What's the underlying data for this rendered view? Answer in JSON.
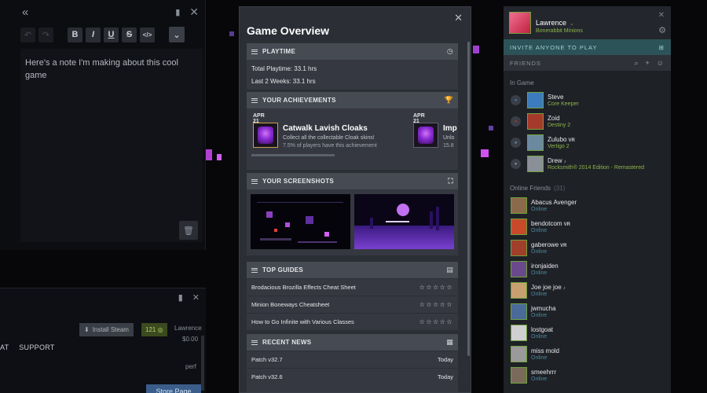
{
  "notes": {
    "note_text": "Here's a note I'm making about this cool game",
    "format_buttons": [
      "B",
      "I",
      "U",
      "S",
      "</>"
    ]
  },
  "store": {
    "install_label": "Install Steam",
    "points": "121",
    "user": "Lawrence",
    "balance": "$0.00",
    "nav": [
      "AT",
      "SUPPORT"
    ],
    "perf": "perf",
    "store_page_label": "Store Page"
  },
  "overview": {
    "title": "Game Overview",
    "playtime": {
      "header": "PLAYTIME",
      "total": "Total Playtime: 33.1 hrs",
      "last_two_weeks": "Last 2 Weeks: 33.1 hrs"
    },
    "achievements": {
      "header": "YOUR ACHIEVEMENTS",
      "items": [
        {
          "date": "APR 21",
          "name": "Catwalk Lavish Cloaks",
          "desc": "Collect all the collectable Cloak skins!",
          "pct": "7.5% of players have this achievement"
        },
        {
          "date": "APR 21",
          "name": "Imp",
          "desc": "Unlo",
          "pct": "15.8"
        }
      ]
    },
    "screenshots": {
      "header": "YOUR SCREENSHOTS"
    },
    "guides": {
      "header": "TOP GUIDES",
      "items": [
        {
          "title": "Brodacious Brozilla Effects Cheat Sheet",
          "stars": "☆☆☆☆☆"
        },
        {
          "title": "Minion Boneways Cheatsheet",
          "stars": "☆☆☆☆☆"
        },
        {
          "title": "How to Go Infinite with Various Classes",
          "stars": "☆☆☆☆☆"
        }
      ]
    },
    "news": {
      "header": "RECENT NEWS",
      "items": [
        {
          "title": "Patch v32.7",
          "when": "Today"
        },
        {
          "title": "Patch v32.6",
          "when": "Today"
        }
      ]
    }
  },
  "friends": {
    "me": {
      "name": "Lawrence",
      "game": "Bonerabbit Minions"
    },
    "invite_label": "INVITE ANYONE TO PLAY",
    "header": "FRIENDS",
    "in_game_label": "In Game",
    "in_game": [
      {
        "name": "Steve",
        "game": "Core Keeper",
        "tag": "",
        "color": "#3d7bbf"
      },
      {
        "name": "Zoid",
        "game": "Destiny 2",
        "tag": "",
        "color": "#a63a2a"
      },
      {
        "name": "Zulubo",
        "game": "Vertigo 2",
        "tag": "VR",
        "color": "#6b8aa0"
      },
      {
        "name": "Drew",
        "game": "Rocksmith® 2014 Edition - Remastered",
        "tag": "♪",
        "color": "#8a8f98"
      }
    ],
    "online_label": "Online Friends",
    "online_count": "(31)",
    "online": [
      {
        "name": "Abacus Avenger",
        "tag": "",
        "status": "Online",
        "color": "#8a6a4a"
      },
      {
        "name": "bendotcom",
        "tag": "VR",
        "status": "Online",
        "color": "#c84a2a"
      },
      {
        "name": "gaberowe",
        "tag": "VR",
        "status": "Online",
        "color": "#a0402a"
      },
      {
        "name": "ironjaiden",
        "tag": "",
        "status": "Online",
        "color": "#6a4a8a"
      },
      {
        "name": "Joe joe joe",
        "tag": "♪",
        "status": "Online",
        "color": "#c8a070"
      },
      {
        "name": "jwmucha",
        "tag": "",
        "status": "Online",
        "color": "#4a6a9a"
      },
      {
        "name": "lostgoat",
        "tag": "",
        "status": "Online",
        "color": "#d0d0d0"
      },
      {
        "name": "miss mold",
        "tag": "",
        "status": "Online",
        "color": "#9a9a9a"
      },
      {
        "name": "smeehrrr",
        "tag": "",
        "status": "Online",
        "color": "#7a6a5a"
      }
    ]
  }
}
